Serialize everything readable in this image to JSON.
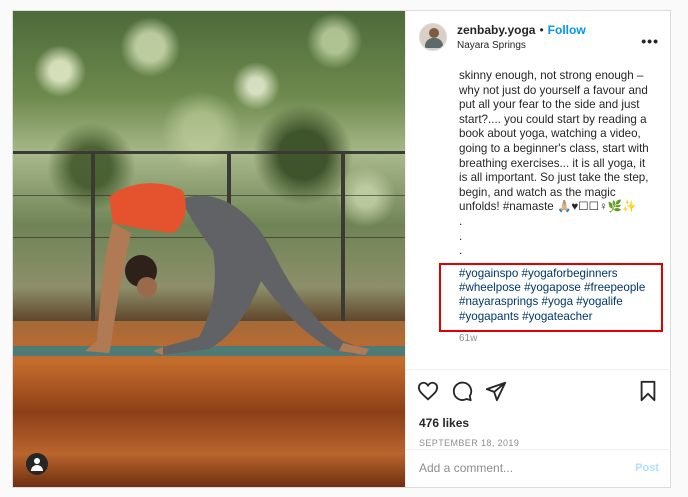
{
  "post": {
    "username": "zenbaby.yoga",
    "dot": "•",
    "follow_label": "Follow",
    "location": "Nayara Springs",
    "more_label": "•••",
    "caption_lines": [
      "skinny enough, not strong enough –",
      "why not just do yourself a favour and",
      "put all your fear to the side and just",
      "start?.... you could start by reading a",
      "book about yoga, watching a video,",
      "going to a beginner's class, start with",
      "breathing exercises... it is all yoga, it",
      "is all important. So just take the step,",
      "begin, and watch as the magic",
      "unfolds! #namaste 🙏🏼♥☐☐♀🌿✨",
      ".",
      ".",
      "."
    ],
    "hashtags": "#yogainspo #yogaforbeginners #wheelpose #yogapose #freepeople #nayarasprings #yoga #yogalife #yogapants #yogateacher",
    "time_ago": "61w",
    "likes": "476 likes",
    "date": "SEPTEMBER 18, 2019",
    "comment_placeholder": "Add a comment...",
    "post_label": "Post"
  },
  "colors": {
    "accent": "#0095f6",
    "hashtag": "#00376b",
    "highlight": "#e00000",
    "muted": "#8e8e8e"
  },
  "icons": [
    "heart-icon",
    "comment-icon",
    "share-icon",
    "bookmark-icon",
    "more-options-icon",
    "user-tag-icon"
  ]
}
